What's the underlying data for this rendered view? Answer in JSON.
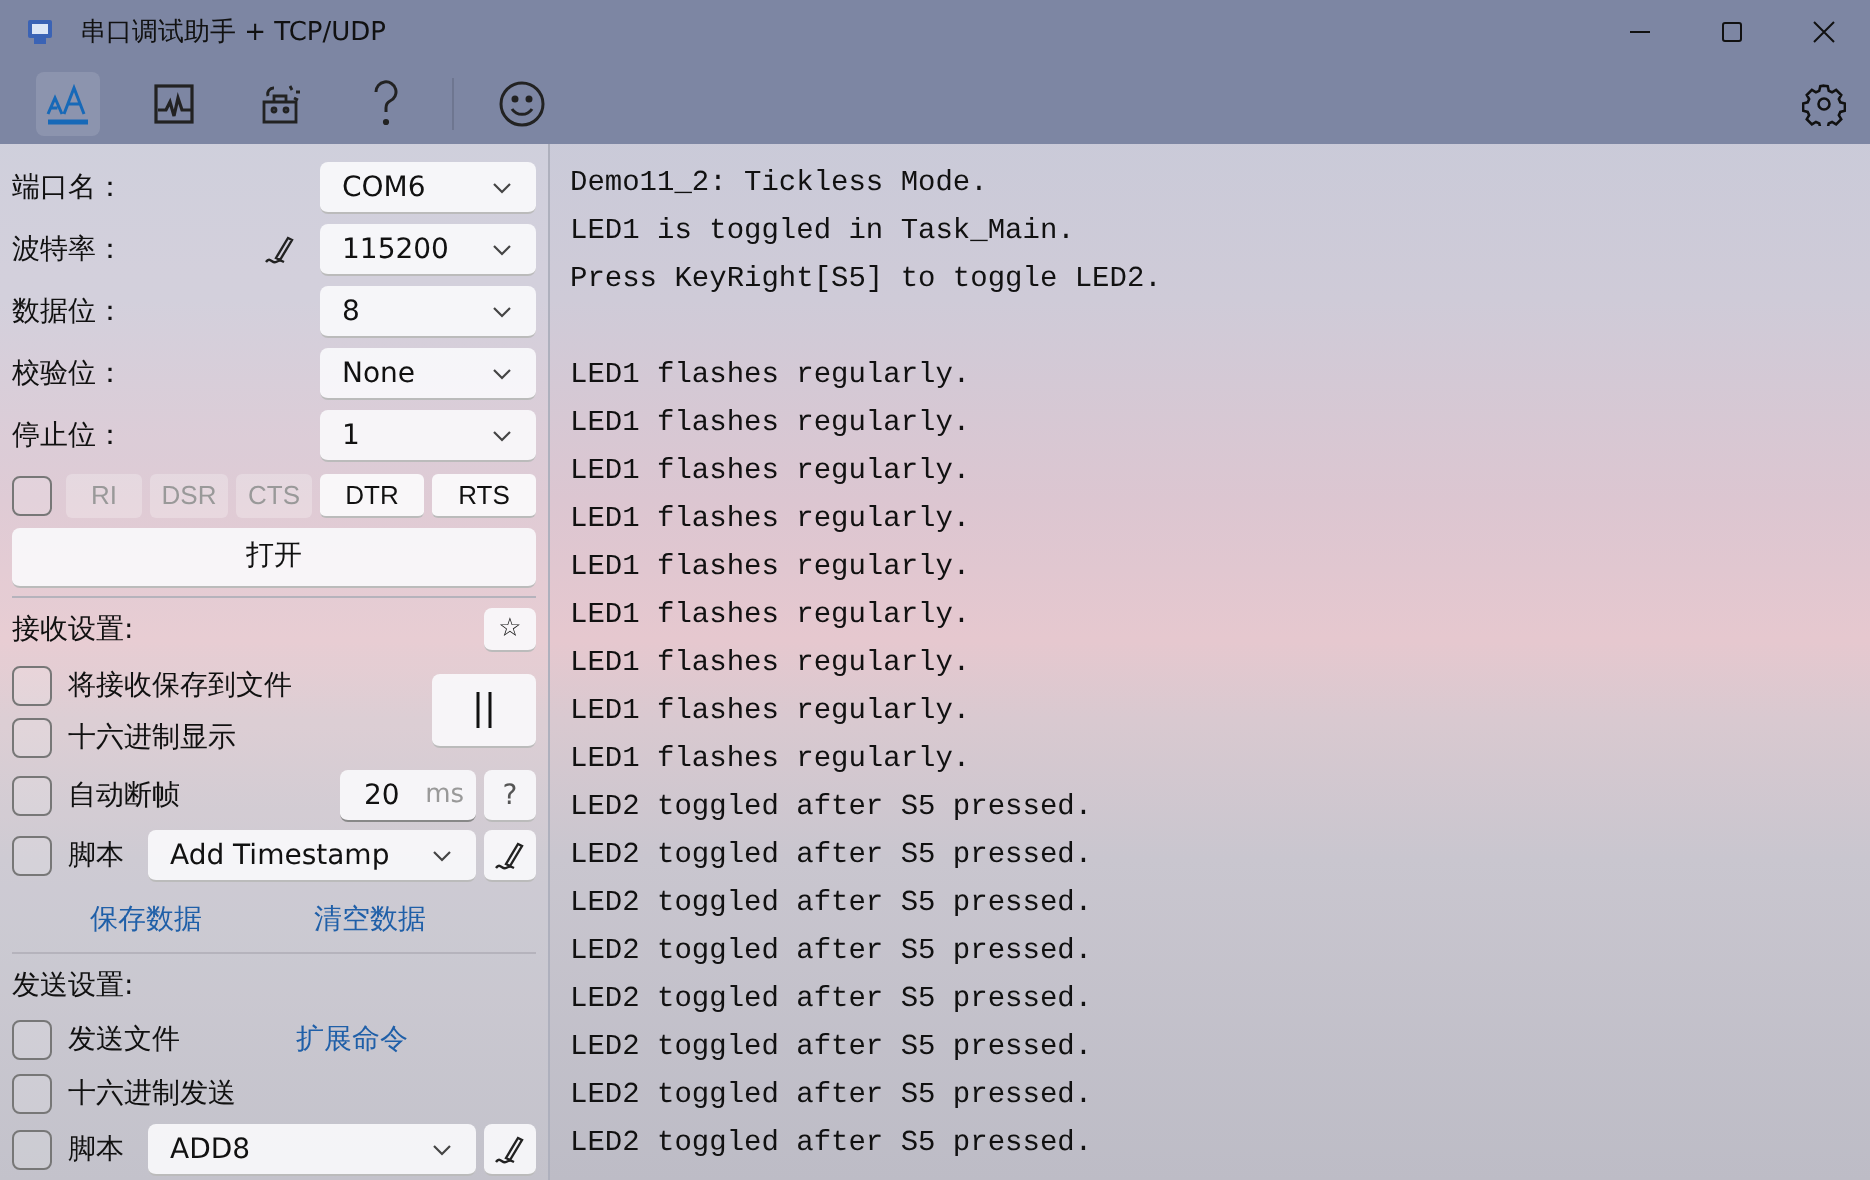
{
  "window": {
    "title": "串口调试助手 + TCP/UDP"
  },
  "toolbar": {
    "tabs": [
      {
        "kind": "font",
        "selected": true
      },
      {
        "kind": "chart",
        "selected": false
      },
      {
        "kind": "robot",
        "selected": false
      },
      {
        "kind": "help",
        "selected": false
      },
      {
        "kind": "smile",
        "selected": false
      }
    ]
  },
  "serial": {
    "fields": [
      {
        "label": "端口名：",
        "value": "COM6",
        "editable": false
      },
      {
        "label": "波特率：",
        "value": "115200",
        "editable": true
      },
      {
        "label": "数据位：",
        "value": "8",
        "editable": false
      },
      {
        "label": "校验位：",
        "value": "None",
        "editable": false
      },
      {
        "label": "停止位：",
        "value": "1",
        "editable": false
      }
    ],
    "signals": {
      "checked": false,
      "pins": [
        {
          "label": "RI",
          "disabled": true
        },
        {
          "label": "DSR",
          "disabled": true
        },
        {
          "label": "CTS",
          "disabled": true
        },
        {
          "label": "DTR",
          "disabled": false
        },
        {
          "label": "RTS",
          "disabled": false
        }
      ]
    },
    "open_button": "打开"
  },
  "receive": {
    "title": "接收设置:",
    "star": "☆",
    "save_to_file": {
      "label": "将接收保存到文件",
      "checked": false
    },
    "hex_display": {
      "label": "十六进制显示",
      "checked": false
    },
    "auto_frame": {
      "label": "自动断帧",
      "checked": false,
      "value": "20",
      "unit": "ms",
      "help": "?"
    },
    "script": {
      "label": "脚本",
      "checked": false,
      "value": "Add Timestamp"
    },
    "links": [
      "保存数据",
      "清空数据"
    ]
  },
  "send": {
    "title": "发送设置:",
    "send_file": {
      "label": "发送文件",
      "checked": false
    },
    "link": "扩展命令",
    "hex_send": {
      "label": "十六进制发送",
      "checked": false
    },
    "script": {
      "label": "脚本",
      "checked": false,
      "value": "ADD8"
    }
  },
  "console": {
    "paragraphs": [
      [
        "Demo11_2: Tickless Mode.",
        "LED1 is toggled in Task_Main.",
        "Press KeyRight[S5] to toggle LED2."
      ],
      [
        "LED1 flashes regularly.",
        "LED1 flashes regularly.",
        "LED1 flashes regularly.",
        "LED1 flashes regularly.",
        "LED1 flashes regularly.",
        "LED1 flashes regularly.",
        "LED1 flashes regularly.",
        "LED1 flashes regularly.",
        "LED1 flashes regularly.",
        "LED2 toggled after S5 pressed.",
        "LED2 toggled after S5 pressed.",
        "LED2 toggled after S5 pressed.",
        "LED2 toggled after S5 pressed.",
        "LED2 toggled after S5 pressed.",
        "LED2 toggled after S5 pressed.",
        "LED2 toggled after S5 pressed.",
        "LED2 toggled after S5 pressed."
      ]
    ]
  }
}
